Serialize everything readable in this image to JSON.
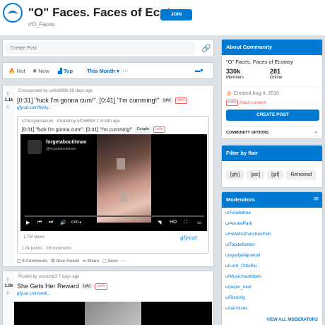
{
  "header": {
    "title": "\"O\" Faces. Faces of Ecstasy.",
    "subreddit": "r/O_Faces",
    "join_label": "JOIN"
  },
  "create_post": {
    "placeholder": "Create Post"
  },
  "sort": {
    "hot": "Hot",
    "new": "New",
    "top": "Top",
    "period": "This Month",
    "more": "···"
  },
  "post1": {
    "score": "1.1k",
    "meta": "Crossposted by u/divi6996 58 days ago",
    "title": "[0:31] \"fuck I'm gonna cum!\". [0:41] \"I'm cumming!\"",
    "flair": "[gfy]",
    "nsfw": "nsfw",
    "domain": "gfycat.com/feisty...",
    "xpost_meta": "r/shesgonnacum · Posted by u/DWB84 1 month ago",
    "xpost_title": "[0:31] \"fuck I'm gonna cum!\". [0:41] \"I'm cumming!\"",
    "xpost_flair": "Couple",
    "channel_name": "forgetaboutitman",
    "channel_handle": "@forgetaboutitman",
    "time_label": "0:00 ●",
    "views": "1.7M views",
    "gfycat": "gfycat",
    "stats": "1.0k points · 26 comments",
    "comments": "9 Comments",
    "give_award": "Give Award",
    "share": "Share",
    "save": "Save",
    "more": "···"
  },
  "post2": {
    "score": "1.0k",
    "meta": "Posted by u/onzinjc2 7 days ago",
    "title": "She Gets Her Reward",
    "flair": "[gfy]",
    "nsfw": "nsfw",
    "domain": "gfycat.com/welli..."
  },
  "about": {
    "head": "About Community",
    "desc": "\"O\" Faces. Faces of Ecstasy",
    "members_value": "330k",
    "members_label": "Members",
    "online_value": "281",
    "online_label": "Online",
    "created": "Created Aug 4, 2010",
    "nsfw": "nsfw",
    "adult": "Adult content",
    "create_btn": "CREATE POST",
    "options": "COMMUNITY OPTIONS"
  },
  "flair_filter": {
    "head": "Filter by flair",
    "chips": [
      "[gfy]",
      "[pic]",
      "[gif]",
      "Removed"
    ]
  },
  "moderators": {
    "head": "Moderators",
    "list": [
      "u/Felafeltree",
      "u/AeratePark",
      "u/HeWhoPunchesFish",
      "u/TopdeBotton",
      "u/eyjafjallajoekull",
      "u/Lord_Cthulhu",
      "u/Musicmantobes",
      "u/pepsi_next",
      "u/RicoVig",
      "u/tarchives"
    ],
    "view_all": "VIEW ALL MODERATORS"
  },
  "colors": {
    "accent": "#0079d3",
    "nsfw": "#ff585b",
    "background": "#dae0e6"
  }
}
